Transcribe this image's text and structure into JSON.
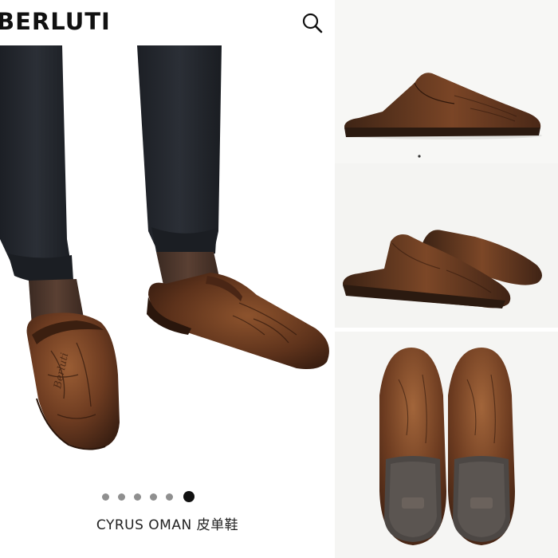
{
  "header": {
    "brand_text": "BERLUTI",
    "search_icon": "search-icon"
  },
  "gallery": {
    "total_slides": 6,
    "active_slide": 6,
    "thumbnail_count": 3
  },
  "product": {
    "name": "CYRUS OMAN 皮单鞋"
  },
  "colors": {
    "leather_dark": "#3a1f12",
    "leather_mid": "#6e3c21",
    "leather_light": "#9a5d34",
    "trousers": "#23262c",
    "dot_inactive": "#8f8f8f",
    "dot_active": "#111111"
  }
}
